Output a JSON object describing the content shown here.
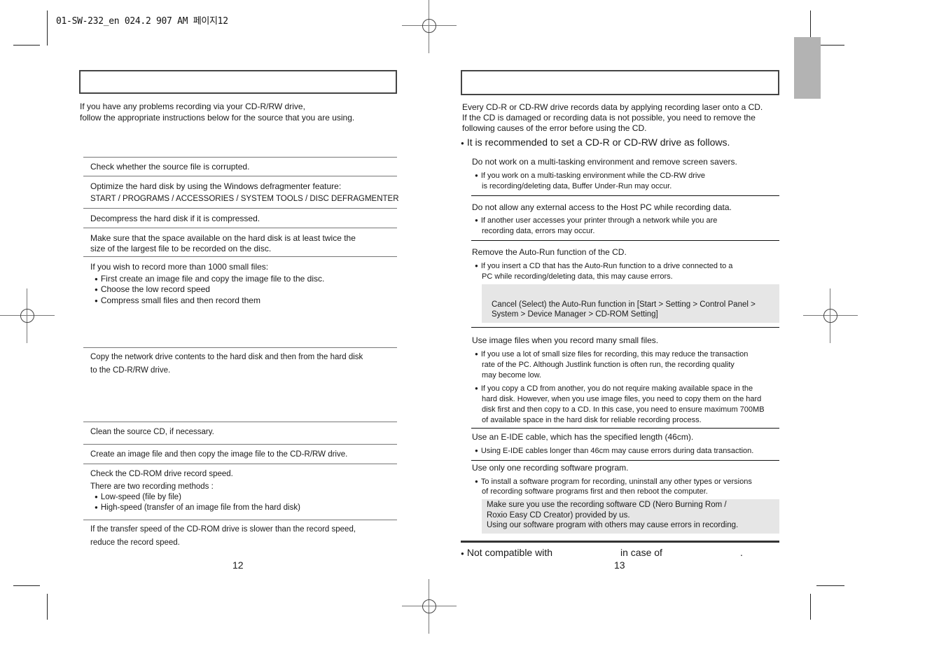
{
  "slug": "01-SW-232_en 024.2 907 AM 페이지12",
  "left_page": {
    "intro": [
      "If you have any problems recording via your CD-R/RW drive,",
      "follow the appropriate instructions below for the source that you are using."
    ],
    "items": [
      "Check whether the source file is corrupted.",
      "Optimize the hard disk by using the Windows defragmenter feature:",
      "START / PROGRAMS / ACCESSORIES / SYSTEM TOOLS / DISC DEFRAGMENTER",
      "Decompress the hard disk if it is compressed.",
      "Make sure that the space available on the hard disk is at least twice the",
      "size of the largest file to be recorded on the disc.",
      "If you wish to record more than 1000 small files:",
      "Copy the network drive contents to the hard disk and then from the hard disk",
      "to the CD-R/RW drive.",
      "Clean the source CD, if necessary.",
      "Create an image file and then copy the image file to the CD-R/RW drive.",
      "Check the CD-ROM drive record speed.",
      "There are two recording methods :",
      "If the transfer speed of the CD-ROM drive is slower than the record speed,",
      "reduce the record speed."
    ],
    "small_files_bullets": [
      "First create an image file and copy the image file to the disc.",
      "Choose the low record speed",
      "Compress small files and then record them"
    ],
    "methods_bullets": [
      "Low-speed (file by file)",
      "High-speed (transfer of an image file from the hard disk)"
    ],
    "page_number": "12"
  },
  "right_page": {
    "intro": [
      "Every CD-R or CD-RW drive records data by applying recording laser onto a CD.",
      "If the CD is damaged or recording data is not possible, you need to remove the",
      "following causes of the error before using the CD."
    ],
    "recommend": "It is recommended to set a CD-R or CD-RW drive as follows.",
    "sections": [
      {
        "heading": "Do not work on a multi-tasking environment and remove screen savers.",
        "bullets": [
          [
            "If you work on a multi-tasking environment while the CD-RW drive",
            "is recording/deleting data, Buffer Under-Run may occur."
          ]
        ]
      },
      {
        "heading": "Do not allow any external access to the Host PC while recording data.",
        "bullets": [
          [
            "If another user accesses your printer through a network while you are",
            "recording data, errors may occur."
          ]
        ]
      },
      {
        "heading": "Remove the Auto-Run function of the CD.",
        "bullets": [
          [
            "If you insert a CD that has the Auto-Run function to a drive connected to a",
            "PC while recording/deleting data, this may cause errors."
          ]
        ],
        "note": [
          "Cancel (Select) the Auto-Run function in [Start > Setting > Control Panel >",
          "System > Device Manager > CD-ROM Setting]"
        ]
      },
      {
        "heading": "Use image files when you record many small files.",
        "bullets": [
          [
            "If you use a lot of small size files for recording, this may reduce the transaction",
            "rate of the PC. Although Justlink function is often run, the recording quality",
            "may become low."
          ],
          [
            "If you copy a CD from another, you do not require making available space in the",
            "hard disk. However, when you use image files, you need to copy them on the hard",
            "disk first and then copy to a CD. In this case, you need to ensure maximum 700MB",
            "of available space in the hard disk for reliable recording process."
          ]
        ]
      },
      {
        "heading": "Use an E-IDE cable, which has the specified length (46cm).",
        "bullets": [
          [
            "Using E-IDE cables longer than 46cm may cause errors during data transaction."
          ]
        ]
      },
      {
        "heading": "Use only one recording software program.",
        "bullets": [
          [
            "To install a software program for recording, uninstall any other types or versions",
            "of recording software programs first and then reboot the computer."
          ]
        ],
        "note": [
          "Make sure you use the recording software CD (Nero Burning Rom /",
          "Roxio Easy CD Creator) provided by us.",
          "Using our software program with others may cause errors in recording."
        ]
      }
    ],
    "footer_note": {
      "part1": "Not compatible with",
      "part2": "in case of",
      "part3": "."
    },
    "page_number": "13"
  }
}
